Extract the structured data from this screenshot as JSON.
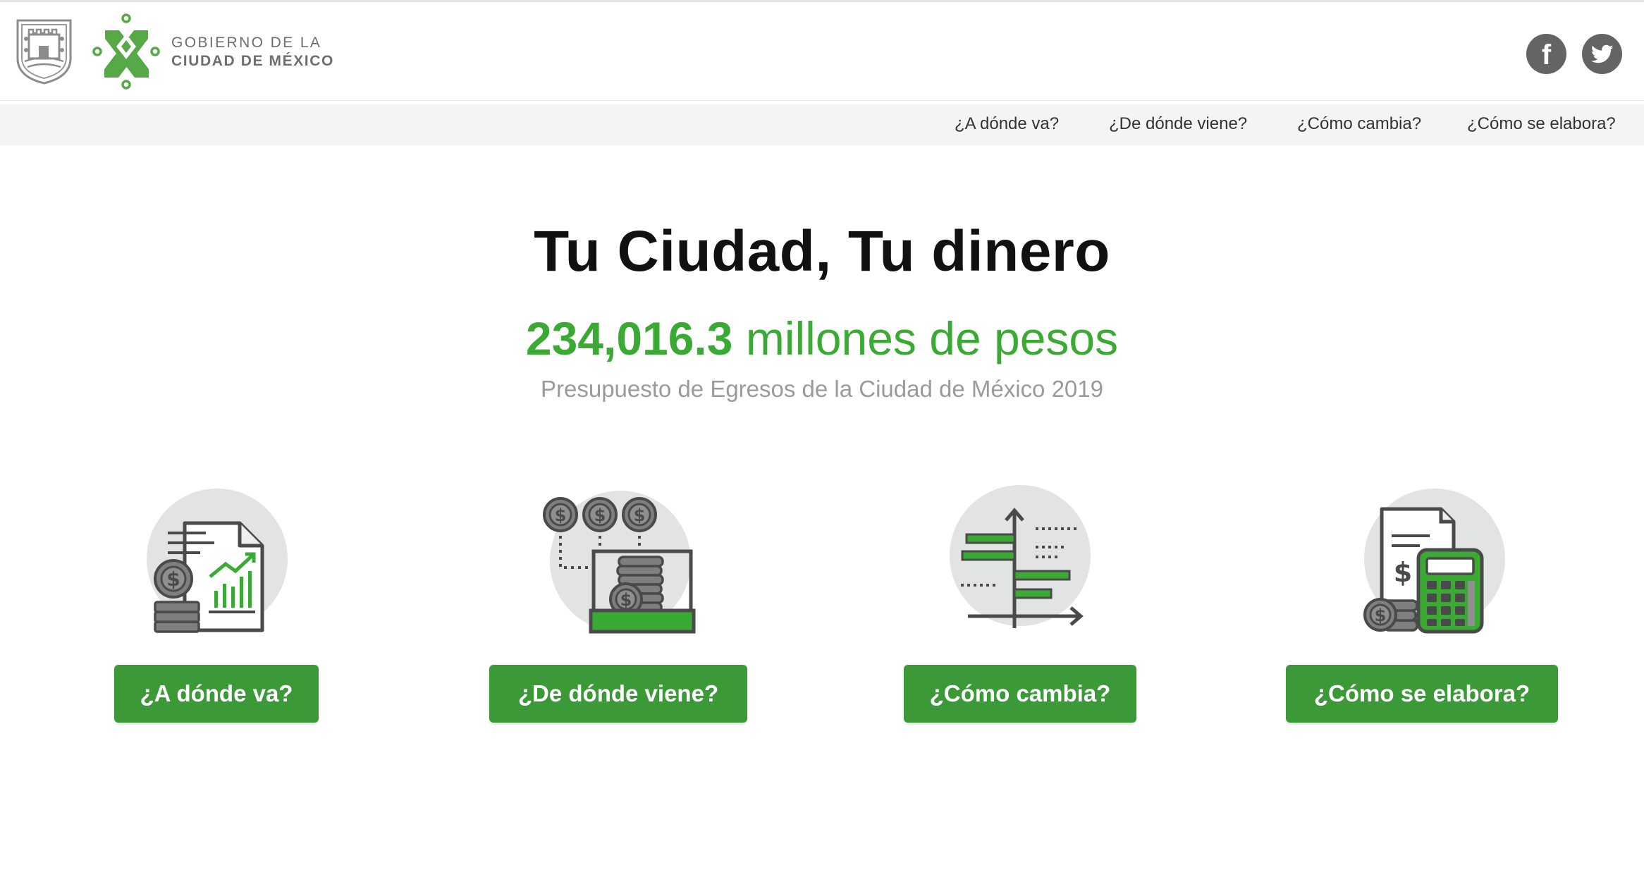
{
  "brand": {
    "line1": "GOBIERNO DE LA",
    "line2": "CIUDAD DE MÉXICO"
  },
  "social": {
    "facebook_glyph": "f"
  },
  "nav": {
    "items": [
      {
        "label": "¿A dónde va?"
      },
      {
        "label": "¿De dónde viene?"
      },
      {
        "label": "¿Cómo cambia?"
      },
      {
        "label": "¿Cómo se elabora?"
      }
    ]
  },
  "hero": {
    "title": "Tu Ciudad, Tu dinero",
    "amount": "234,016.3",
    "amount_unit": "millones de pesos",
    "subtitle": "Presupuesto de Egresos de la Ciudad de México 2019"
  },
  "cards": [
    {
      "button": "¿A dónde va?",
      "icon": "document-chart-coins-icon"
    },
    {
      "button": "¿De dónde viene?",
      "icon": "coins-income-icon"
    },
    {
      "button": "¿Cómo cambia?",
      "icon": "bar-chart-change-icon"
    },
    {
      "button": "¿Cómo se elabora?",
      "icon": "calculator-document-icon"
    }
  ],
  "colors": {
    "accent_green": "#3aaa35",
    "button_green": "#3b9a37",
    "icon_gray": "#646464"
  }
}
